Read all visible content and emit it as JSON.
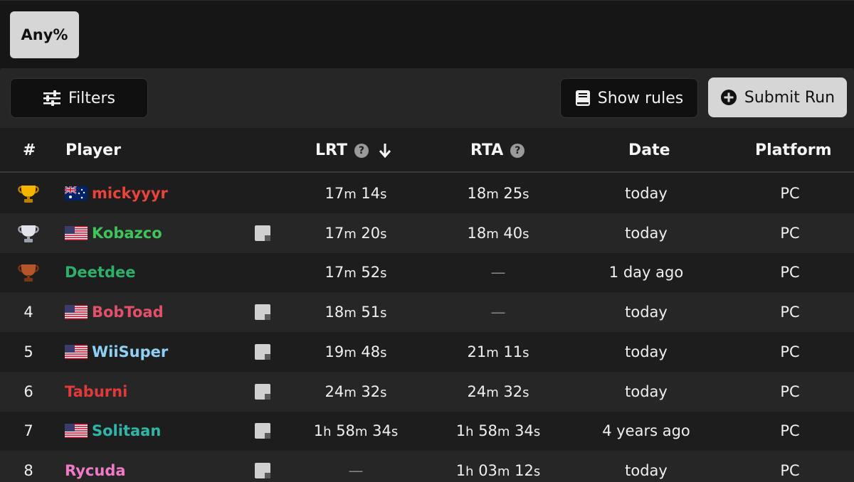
{
  "category": {
    "label": "Any%"
  },
  "toolbar": {
    "filters_label": "Filters",
    "show_rules_label": "Show rules",
    "submit_label": "Submit Run"
  },
  "columns": {
    "rank": "#",
    "player": "Player",
    "lrt": "LRT",
    "rta": "RTA",
    "date": "Date",
    "platform": "Platform"
  },
  "rows": [
    {
      "rank": "trophy-gold",
      "flag": "AU",
      "player": "mickyyyr",
      "color": "#e8443a",
      "note": false,
      "lrt": {
        "m": "17",
        "s": "14"
      },
      "rta": {
        "m": "18",
        "s": "25"
      },
      "date": "today",
      "platform": "PC"
    },
    {
      "rank": "trophy-silver",
      "flag": "US",
      "player": "Kobazco",
      "color": "#3fc35b",
      "note": true,
      "lrt": {
        "m": "17",
        "s": "20"
      },
      "rta": {
        "m": "18",
        "s": "40"
      },
      "date": "today",
      "platform": "PC"
    },
    {
      "rank": "trophy-bronze",
      "flag": "",
      "player": "Deetdee",
      "color": "#2db06a",
      "note": false,
      "lrt": {
        "m": "17",
        "s": "52"
      },
      "rta": null,
      "date": "1 day ago",
      "platform": "PC"
    },
    {
      "rank": "4",
      "flag": "US",
      "player": "BobToad",
      "color": "#e2506a",
      "note": true,
      "lrt": {
        "m": "18",
        "s": "51"
      },
      "rta": null,
      "date": "today",
      "platform": "PC"
    },
    {
      "rank": "5",
      "flag": "US",
      "player": "WiiSuper",
      "color": "#8fd0f5",
      "note": true,
      "lrt": {
        "m": "19",
        "s": "48"
      },
      "rta": {
        "m": "21",
        "s": "11"
      },
      "date": "today",
      "platform": "PC"
    },
    {
      "rank": "6",
      "flag": "",
      "player": "Taburni",
      "color": "#e03a3a",
      "note": true,
      "lrt": {
        "m": "24",
        "s": "32"
      },
      "rta": {
        "m": "24",
        "s": "32"
      },
      "date": "today",
      "platform": "PC"
    },
    {
      "rank": "7",
      "flag": "US",
      "player": "Solitaan",
      "color": "#2fb6a8",
      "note": true,
      "lrt": {
        "h": "1",
        "m": "58",
        "s": "34"
      },
      "rta": {
        "h": "1",
        "m": "58",
        "s": "34"
      },
      "date": "4 years ago",
      "platform": "PC"
    },
    {
      "rank": "8",
      "flag": "",
      "player": "Rycuda",
      "color": "#f07ac8",
      "note": true,
      "lrt": null,
      "rta": {
        "h": "1",
        "m": "03",
        "s": "12"
      },
      "date": "today",
      "platform": "PC"
    }
  ],
  "empty_time": "—",
  "units": {
    "h": "h",
    "m": "m",
    "s": "s"
  },
  "icons": {
    "filters": "sliders-icon",
    "rules": "book-icon",
    "submit": "plus-circle-icon",
    "help": "question-circle-icon",
    "sort": "arrow-down-icon"
  }
}
